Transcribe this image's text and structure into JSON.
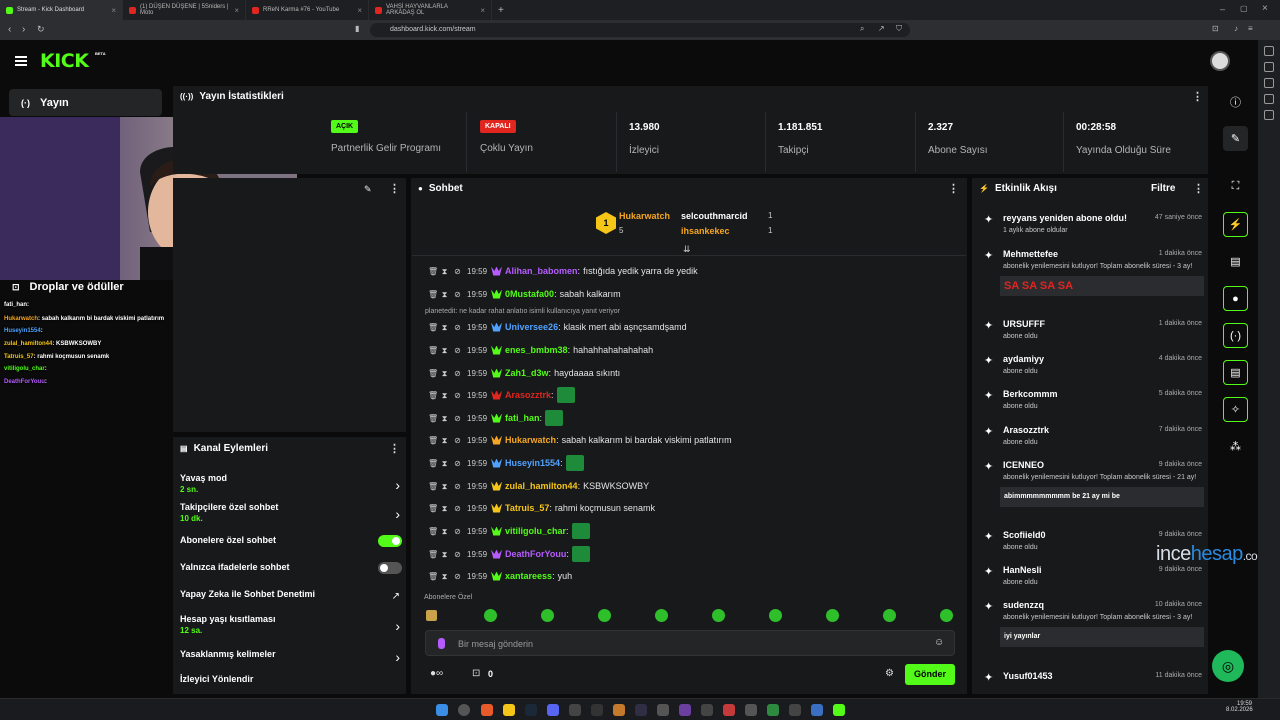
{
  "browser": {
    "tabs": [
      {
        "label": "Stream - Kick Dashboard",
        "active": true
      },
      {
        "label": "(1) DÜŞEN DÜŞENE | 5Sniders | Moto",
        "active": false
      },
      {
        "label": "RReN Karma #76 - YouTube",
        "active": false
      },
      {
        "label": "VAHŞİ HAYVANLARLA ARKADAŞ OL",
        "active": false
      }
    ],
    "new_tab": "+",
    "url": "dashboard.kick.com/stream"
  },
  "header": {
    "logo": "KICK",
    "beta": "BETA"
  },
  "nav": {
    "stream_label": "Yayın",
    "drops_label": "Droplar ve ödüller"
  },
  "stats": {
    "title": "Yayın İstatistikleri",
    "items": [
      {
        "badge": "AÇIK",
        "label": "Partnerlik Gelir Programı"
      },
      {
        "badge": "KAPALI",
        "label": "Çoklu Yayın"
      },
      {
        "value": "13.980",
        "label": "İzleyici"
      },
      {
        "value": "1.181.851",
        "label": "Takipçi"
      },
      {
        "value": "2.327",
        "label": "Abone Sayısı"
      },
      {
        "value": "00:28:58",
        "label": "Yayında Olduğu Süre"
      }
    ]
  },
  "overlay_chat": [
    {
      "user": "fati_han",
      "msg": ":",
      "color": "#ffffff"
    },
    {
      "user": "Hukarwatch",
      "msg": ": sabah kalkarım bi bardak viskimi patlatırım",
      "color": "#f5a623"
    },
    {
      "user": "Huseyin1554",
      "msg": ":",
      "color": "#4fa3ff"
    },
    {
      "user": "zulal_hamilton44",
      "msg": ": KSBWKSOWBY",
      "color": "#f5c518"
    },
    {
      "user": "Tatruis_57",
      "msg": ": rahmi koçmusun senamk",
      "color": "#f5c518"
    },
    {
      "user": "vitiligolu_char",
      "msg": ":",
      "color": "#53fc18"
    },
    {
      "user": "DeathForYouu",
      "msg": ":",
      "color": "#b65cff"
    }
  ],
  "chat": {
    "title": "Sohbet",
    "top_gifters": [
      {
        "rank": "1",
        "name": "Hukarwatch",
        "count": "5"
      },
      {
        "name": "selcouthmarcid",
        "count": "1"
      },
      {
        "name": "ihsankekec",
        "count": "1"
      }
    ],
    "reply_hint": "planetedit: ne kadar rahat anlatıo isimli kullanıcıya yanıt veriyor",
    "messages": [
      {
        "time": "19:59",
        "user": "Alihan_babomen",
        "color": "#b65cff",
        "msg": "fıstığıda yedik yarra de yedik"
      },
      {
        "time": "19:59",
        "user": "0Mustafa00",
        "color": "#53fc18",
        "msg": "sabah kalkarım"
      },
      {
        "time": "19:59",
        "user": "Universee26",
        "color": "#4fa3ff",
        "msg": "klasik mert abi aşnçsamdşamd"
      },
      {
        "time": "19:59",
        "user": "enes_bmbm38",
        "color": "#53fc18",
        "msg": "hahahhahahahahah"
      },
      {
        "time": "19:59",
        "user": "Zah1_d3w",
        "color": "#53fc18",
        "msg": "haydaaaa sıkıntı"
      },
      {
        "time": "19:59",
        "user": "Arasozztrk",
        "color": "#e0261f",
        "msg": ""
      },
      {
        "time": "19:59",
        "user": "fati_han",
        "color": "#53fc18",
        "msg": ""
      },
      {
        "time": "19:59",
        "user": "Hukarwatch",
        "color": "#f5a623",
        "msg": "sabah kalkarım bi bardak viskimi patlatırım"
      },
      {
        "time": "19:59",
        "user": "Huseyin1554",
        "color": "#4fa3ff",
        "msg": ""
      },
      {
        "time": "19:59",
        "user": "zulal_hamilton44",
        "color": "#f5c518",
        "msg": "KSBWKSOWBY"
      },
      {
        "time": "19:59",
        "user": "Tatruis_57",
        "color": "#f5c518",
        "msg": "rahmi koçmusun senamk"
      },
      {
        "time": "19:59",
        "user": "vitiligolu_char",
        "color": "#53fc18",
        "msg": ""
      },
      {
        "time": "19:59",
        "user": "DeathForYouu",
        "color": "#b65cff",
        "msg": ""
      },
      {
        "time": "19:59",
        "user": "xantareess",
        "color": "#53fc18",
        "msg": "yuh"
      }
    ],
    "subs_only": "Abonelere Özel",
    "input_placeholder": "Bir mesaj gönderin",
    "points": "0",
    "send": "Gönder"
  },
  "actions": {
    "title": "Kanal Eylemleri",
    "items": [
      {
        "title": "Yavaş mod",
        "sub": "2 sn."
      },
      {
        "title": "Takipçilere özel sohbet",
        "sub": "10 dk."
      },
      {
        "title": "Abonelere özel sohbet",
        "sub": ""
      },
      {
        "title": "Yalnızca ifadelerle sohbet",
        "sub": ""
      },
      {
        "title": "Yapay Zeka ile Sohbet Denetimi",
        "sub": ""
      },
      {
        "title": "Hesap yaşı kısıtlaması",
        "sub": "12 sa."
      },
      {
        "title": "Yasaklanmış kelimeler",
        "sub": ""
      },
      {
        "title": "İzleyici Yönlendir",
        "sub": ""
      }
    ]
  },
  "activity": {
    "title": "Etkinlik Akışı",
    "filter": "Filtre",
    "events": [
      {
        "name": "reyyans yeniden abone oldu!",
        "sub": "1 aylık abone oldular",
        "when": "47 saniye önce"
      },
      {
        "name": "Mehmettefee",
        "sub": "abonelik yenilemesini kutluyor! Toplam abonelik süresi - 3 ay!",
        "when": "1 dakika önce",
        "quote": "SA SA SA SA"
      },
      {
        "name": "URSUFFF",
        "sub": "abone oldu",
        "when": "1 dakika önce"
      },
      {
        "name": "aydamiyy",
        "sub": "abone oldu",
        "when": "4 dakika önce"
      },
      {
        "name": "Berkcommm",
        "sub": "abone oldu",
        "when": "5 dakika önce"
      },
      {
        "name": "Arasozztrk",
        "sub": "abone oldu",
        "when": "7 dakika önce"
      },
      {
        "name": "ICENNEO",
        "sub": "abonelik yenilemesini kutluyor! Toplam abonelik süresi - 21 ay!",
        "when": "9 dakika önce",
        "quote": "abimmmmmmmmm be 21 ay mi be"
      },
      {
        "name": "Scofiield0",
        "sub": "abone oldu",
        "when": "9 dakika önce"
      },
      {
        "name": "HanNesli",
        "sub": "abone oldu",
        "when": "9 dakika önce"
      },
      {
        "name": "sudenzzq",
        "sub": "abonelik yenilemesini kutluyor! Toplam abonelik süresi - 3 ay!",
        "when": "10 dakika önce",
        "quote": "iyi yayınlar"
      },
      {
        "name": "Yusuf01453",
        "sub": "",
        "when": "11 dakika önce"
      }
    ]
  },
  "watermark": {
    "a": "ince",
    "b": "hesap",
    "c": ".com"
  },
  "clock": {
    "time": "19:59",
    "date": "8.02.2026"
  },
  "colors": {
    "accent": "#53fc18",
    "panel": "#18191b",
    "bg": "#0b0b0c"
  }
}
